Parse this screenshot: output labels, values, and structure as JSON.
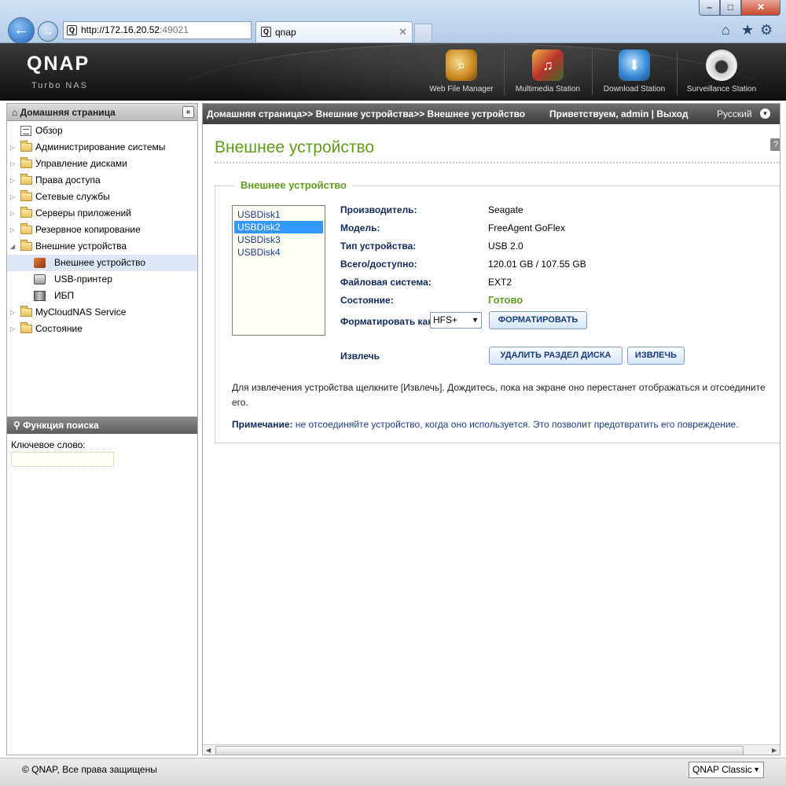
{
  "browser": {
    "url_main": "http://172.16.20.52",
    "url_port": ":49021",
    "tab_title": "qnap",
    "address_tools": "⚲▾⊡↻✕"
  },
  "header": {
    "logo": "QNAP",
    "logo_sub": "Turbo NAS",
    "apps": [
      {
        "label": "Web File Manager"
      },
      {
        "label": "Multimedia Station"
      },
      {
        "label": "Download Station"
      },
      {
        "label": "Surveillance Station"
      }
    ]
  },
  "sidebar": {
    "title": "Домашняя страница",
    "items": [
      {
        "label": "Обзор"
      },
      {
        "label": "Администрирование системы"
      },
      {
        "label": "Управление дисками"
      },
      {
        "label": "Права доступа"
      },
      {
        "label": "Сетевые службы"
      },
      {
        "label": "Серверы приложений"
      },
      {
        "label": "Резервное копирование"
      },
      {
        "label": "Внешние устройства"
      },
      {
        "label": "Внешнее устройство"
      },
      {
        "label": "USB-принтер"
      },
      {
        "label": "ИБП"
      },
      {
        "label": "MyCloudNAS Service"
      },
      {
        "label": "Состояние"
      }
    ]
  },
  "search": {
    "title": "Функция поиска",
    "keyword_label": "Ключевое слово:",
    "keyword_value": ""
  },
  "topbar": {
    "breadcrumb": "Домашняя страница>> Внешние устройства>> Внешнее устройство",
    "welcome": "Приветствуем, admin | Выход",
    "language": "Русский"
  },
  "main": {
    "title": "Внешнее устройство",
    "help": "?",
    "section_title": "Внешнее устройство",
    "disks": [
      "USBDisk1",
      "USBDisk2",
      "USBDisk3",
      "USBDisk4"
    ],
    "selected_disk": "USBDisk2",
    "props": {
      "vendor_label": "Производитель:",
      "vendor_value": "Seagate",
      "model_label": "Модель:",
      "model_value": "FreeAgent GoFlex",
      "type_label": "Тип устройства:",
      "type_value": "USB 2.0",
      "capacity_label": "Всего/доступно:",
      "capacity_value": "120.01 GB / 107.55 GB",
      "fs_label": "Файловая система:",
      "fs_value": "EXT2",
      "status_label": "Состояние:",
      "status_value": "Готово"
    },
    "format_label": "Форматировать как",
    "format_value": "HFS+",
    "format_button": "ФОРМАТИРОВАТЬ",
    "eject_label": "Извлечь",
    "delete_partition_button": "УДАЛИТЬ РАЗДЕЛ ДИСКА",
    "eject_button": "ИЗВЛЕЧЬ",
    "note1": "Для извлечения устройства щелкните [Извлечь]. Дождитесь, пока на экране оно перестанет отображаться и отсоедините его.",
    "note2_label": "Примечание:",
    "note2_text": " не отсоединяйте устройство, когда оно используется. Это позволит предотвратить его повреждение."
  },
  "footer": {
    "copyright": "© QNAP, Все права защищены",
    "theme": "QNAP Classic"
  },
  "colors": {
    "accent_green": "#5e9c1a",
    "link_blue": "#1c3e8a",
    "selection_blue": "#3399ff"
  }
}
